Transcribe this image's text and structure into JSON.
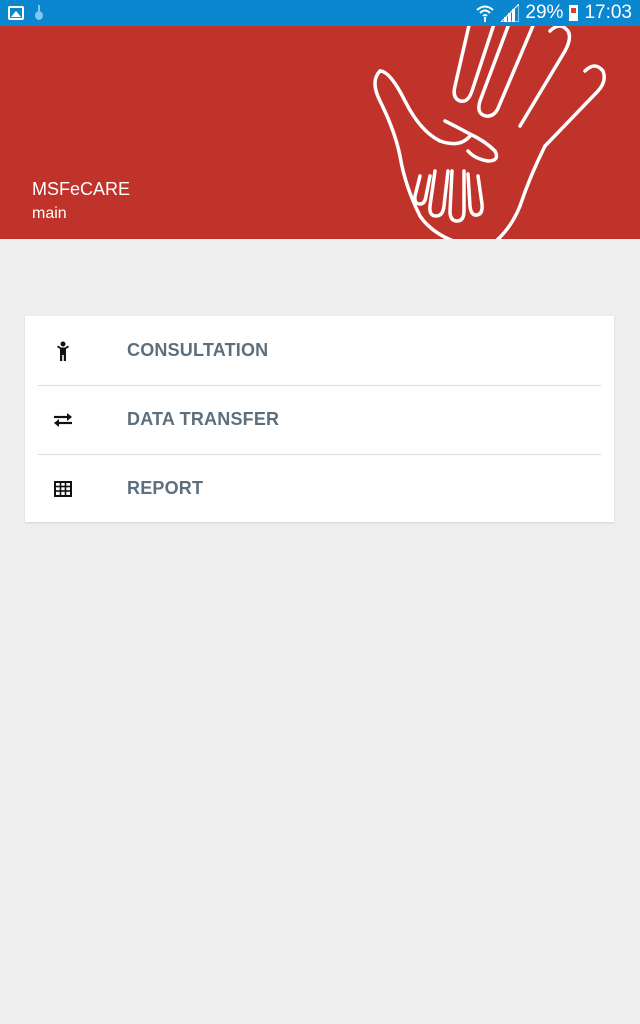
{
  "status_bar": {
    "battery_percent": "29%",
    "time": "17:03"
  },
  "header": {
    "title": "MSFeCARE",
    "subtitle": "main",
    "color": "#c0332a"
  },
  "menu": {
    "items": [
      {
        "label": "CONSULTATION",
        "icon": "child-icon"
      },
      {
        "label": "DATA TRANSFER",
        "icon": "swap-arrows-icon"
      },
      {
        "label": "REPORT",
        "icon": "table-icon"
      }
    ]
  },
  "colors": {
    "status_bar": "#0a87cf",
    "background": "#eeeeee",
    "label": "#5d6f7d"
  }
}
